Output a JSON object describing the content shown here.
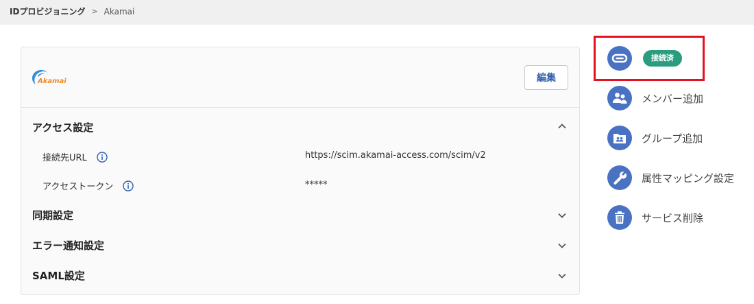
{
  "breadcrumb": {
    "parent": "IDプロビジョニング",
    "separator": ">",
    "current": "Akamai"
  },
  "service": {
    "logo_text": "Akamai",
    "edit_label": "編集"
  },
  "sections": {
    "access": {
      "title": "アクセス設定",
      "rows": [
        {
          "label": "接続先URL",
          "value": "https://scim.akamai-access.com/scim/v2"
        },
        {
          "label": "アクセストークン",
          "value": "*****"
        }
      ]
    },
    "sync": {
      "title": "同期設定"
    },
    "error": {
      "title": "エラー通知設定"
    },
    "saml": {
      "title": "SAML設定"
    }
  },
  "actions": {
    "connected_badge": "接続済",
    "add_member": "メンバー追加",
    "add_group": "グループ追加",
    "attribute_mapping": "属性マッピング設定",
    "delete_service": "サービス削除"
  },
  "colors": {
    "accent_blue": "#4a72c2",
    "badge_green": "#2a9d7f",
    "highlight_red": "#e3101f",
    "logo_orange": "#f08a24",
    "logo_blue": "#2f8fd8"
  },
  "icons": {
    "connect": "link-icon",
    "member": "users-icon",
    "group": "group-folder-icon",
    "mapping": "wrench-icon",
    "delete": "trash-icon",
    "info": "info-icon",
    "expand": "chevron-down-icon",
    "collapse": "chevron-up-icon"
  }
}
